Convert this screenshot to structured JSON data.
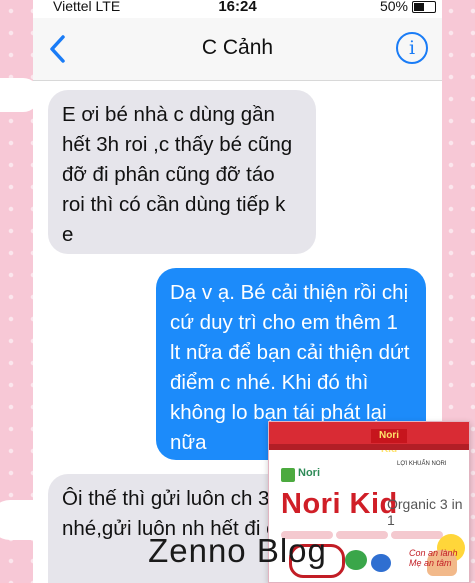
{
  "status_bar": {
    "carrier": "Viettel  LTE",
    "time": "16:24",
    "battery": "50%"
  },
  "nav": {
    "back_icon": "chevron-left-icon",
    "title": "C Cảnh",
    "info_label": "i",
    "info_icon": "info-icon",
    "accent": "#1a7cf6"
  },
  "messages": [
    {
      "direction": "incoming",
      "text": "E ơi bé nhà c dùng gần hết 3h roi ,c thấy bé cũng đỡ đi phân cũng đỡ táo roi thì có cần dùng tiếp k e"
    },
    {
      "direction": "outgoing",
      "text": "Dạ v ạ. Bé cải thiện rồi chị cứ duy trì cho em thêm 1 lt nữa để bạn cải thiện dứt điểm c nhé. Khi đó thì không lo bạn tái phát lại nữa"
    },
    {
      "direction": "incoming",
      "text": "Ôi thế thì gửi luôn ch 3h đi nhé,gửi luôn nh hết đi em"
    }
  ],
  "bubble_colors": {
    "incoming": "#e6e5eb",
    "outgoing": "#1c8bfa"
  },
  "product": {
    "band_tag": "Nori Kid",
    "brand": "Nori",
    "note": "LỢI KHUẨN NORI",
    "name": "Nori Kid",
    "variant": "Organic 3 in 1",
    "slogan": "Con an lành Mẹ an tâm"
  },
  "watermark": "Zenno Blog"
}
